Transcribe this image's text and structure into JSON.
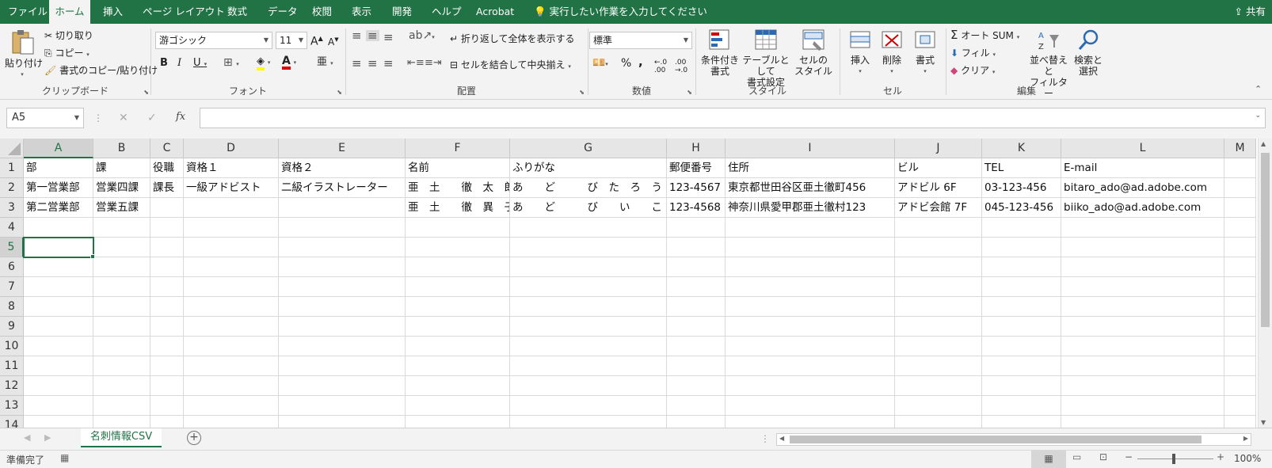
{
  "ribbon_tabs": [
    "ファイル",
    "ホーム",
    "挿入",
    "ページ レイアウト",
    "数式",
    "データ",
    "校閲",
    "表示",
    "開発",
    "ヘルプ",
    "Acrobat"
  ],
  "tell_me": "実行したい作業を入力してください",
  "share": "共有",
  "clipboard": {
    "paste": "貼り付け",
    "cut": "切り取り",
    "copy": "コピー",
    "format_painter": "書式のコピー/貼り付け",
    "label": "クリップボード"
  },
  "font": {
    "name": "游ゴシック",
    "size": "11",
    "bold": "B",
    "italic": "I",
    "underline": "U",
    "label": "フォント"
  },
  "alignment": {
    "wrap": "折り返して全体を表示する",
    "merge": "セルを結合して中央揃え",
    "label": "配置"
  },
  "number": {
    "format": "標準",
    "percent": "%",
    "comma": ",",
    "label": "数値"
  },
  "styles": {
    "conditional": "条件付き\n書式",
    "table": "テーブルとして\n書式設定",
    "cell_styles": "セルの\nスタイル",
    "label": "スタイル"
  },
  "cells": {
    "insert": "挿入",
    "delete": "削除",
    "format": "書式",
    "label": "セル"
  },
  "editing": {
    "autosum": "オート SUM",
    "fill": "フィル",
    "clear": "クリア",
    "sort": "並べ替えと\nフィルター",
    "find": "検索と\n選択",
    "label": "編集"
  },
  "name_box": "A5",
  "fx": "fx",
  "columns": [
    "A",
    "B",
    "C",
    "D",
    "E",
    "F",
    "G",
    "H",
    "I",
    "J",
    "K",
    "L",
    "M"
  ],
  "row_numbers": [
    "1",
    "2",
    "3",
    "4",
    "5",
    "6",
    "7",
    "8",
    "9",
    "10",
    "11",
    "12",
    "13",
    "14"
  ],
  "rows": [
    [
      "部",
      "課",
      "役職",
      "資格１",
      "資格２",
      "名前",
      "ふりがな",
      "郵便番号",
      "住所",
      "ビル",
      "TEL",
      "E-mail"
    ],
    [
      "第一営業部",
      "営業四課",
      "課長",
      "一級アドビスト",
      "二級イラストレーター",
      "亜　土　　徹　太　郎",
      "あ　　ど　　　び　た　ろ　う",
      "123-4567",
      "東京都世田谷区亜土徹町456",
      "アドビル 6F",
      "03-123-456",
      "bitaro_ado@ad.adobe.com"
    ],
    [
      "第二営業部",
      "営業五課",
      "",
      "",
      "",
      "亜　土　　徹　異　子",
      "あ　　ど　　　び　　い　　こ",
      "123-4568",
      "神奈川県愛甲郡亜土徹村123",
      "アドビ会館 7F",
      "045-123-456",
      "biiko_ado@ad.adobe.com"
    ]
  ],
  "sheet_tab": "名刺情報CSV",
  "status": "準備完了",
  "zoom": "100%",
  "accent": "#217346"
}
